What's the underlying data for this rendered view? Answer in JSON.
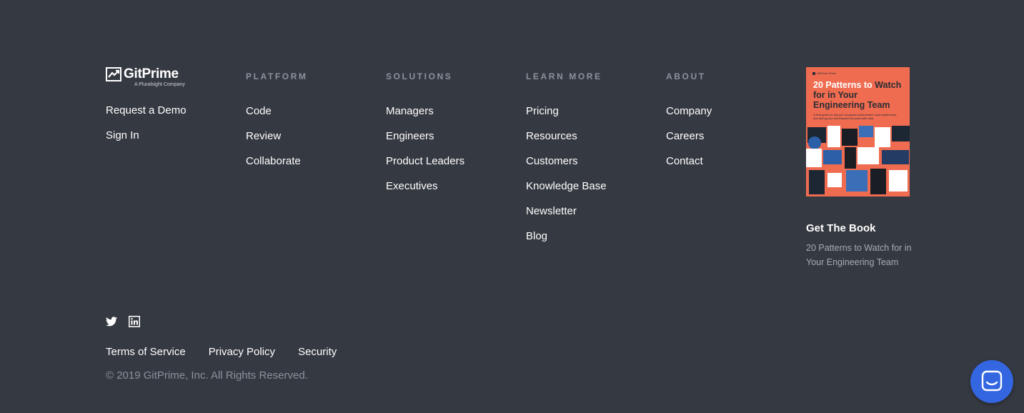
{
  "brand": {
    "name": "GitPrime",
    "tagline": "A Pluralsight Company",
    "links": [
      "Request a Demo",
      "Sign In"
    ]
  },
  "columns": [
    {
      "heading": "PLATFORM",
      "links": [
        "Code",
        "Review",
        "Collaborate"
      ]
    },
    {
      "heading": "SOLUTIONS",
      "links": [
        "Managers",
        "Engineers",
        "Product Leaders",
        "Executives"
      ]
    },
    {
      "heading": "LEARN MORE",
      "links": [
        "Pricing",
        "Resources",
        "Customers",
        "Knowledge Base",
        "Newsletter",
        "Blog"
      ]
    },
    {
      "heading": "ABOUT",
      "links": [
        "Company",
        "Careers",
        "Contact"
      ]
    }
  ],
  "book": {
    "cover_brand": "GitPrime Press",
    "cover_title_highlight": "20 Patterns",
    "cover_title_mid": " to",
    "cover_title_rest": "Watch for in Your Engineering Team",
    "cover_subtitle": "A field guide to help you recognize achievement, spot bottlenecks, and debug your development process with data.",
    "heading": "Get The Book",
    "description": "20 Patterns to Watch for in Your Engineering Team"
  },
  "social": {
    "icons": [
      "twitter-icon",
      "linkedin-icon"
    ]
  },
  "legal": {
    "links": [
      "Terms of Service",
      "Privacy Policy",
      "Security"
    ],
    "copyright": "© 2019 GitPrime, Inc. All Rights Reserved."
  },
  "chat": {
    "icon": "chat-icon"
  },
  "colors": {
    "background": "#353941",
    "heading": "#8c919b",
    "book_cover": "#ef6c51",
    "chat_button": "#3366e0"
  }
}
